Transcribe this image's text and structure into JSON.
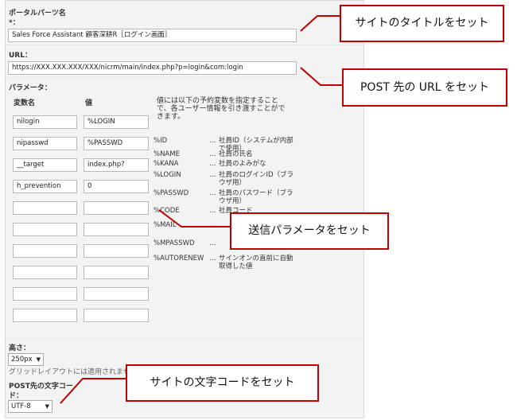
{
  "form": {
    "portal_parts_name": {
      "label": "ポータルパーツ名",
      "required": "*：",
      "value": "Sales Force Assistant 顧客深耕R［ログイン画面］"
    },
    "url": {
      "label": "URL：",
      "value": "https://XXX.XXX.XXX/XXX/nicrm/main/index.php?p=login&com:login"
    },
    "params": {
      "label": "パラメータ：",
      "col_name": "変数名",
      "col_value": "値",
      "rows": [
        {
          "name": "nilogin",
          "value": "%LOGIN"
        },
        {
          "name": "nipasswd",
          "value": "%PASSWD"
        },
        {
          "name": "__target",
          "value": "index.php?"
        },
        {
          "name": "h_prevention",
          "value": "0"
        },
        {
          "name": "",
          "value": ""
        },
        {
          "name": "",
          "value": ""
        },
        {
          "name": "",
          "value": ""
        },
        {
          "name": "",
          "value": ""
        },
        {
          "name": "",
          "value": ""
        },
        {
          "name": "",
          "value": ""
        }
      ],
      "help": "値には以下の予約変数を指定することで、各ユーザー情報を引き渡すことができます。",
      "reserved": [
        {
          "name": "%ID",
          "dots": "…",
          "desc": "社員ID（システムが内部で使用）"
        },
        {
          "name": "%NAME",
          "dots": "…",
          "desc": "社員の氏名"
        },
        {
          "name": "%KANA",
          "dots": "…",
          "desc": "社員のよみがな"
        },
        {
          "name": "%LOGIN",
          "dots": "…",
          "desc": "社員のログインID（ブラウザ用）"
        },
        {
          "name": "%PASSWD",
          "dots": "…",
          "desc": "社員のパスワード（ブラウザ用）"
        },
        {
          "name": "%CODE",
          "dots": "…",
          "desc": "社員コード"
        },
        {
          "name": "%MAIL",
          "dots": "…",
          "desc": ""
        },
        {
          "name": "%MPASSWD",
          "dots": "…",
          "desc": ""
        },
        {
          "name": "%AUTORENEW",
          "dots": "…",
          "desc": "サインオンの直前に自動取得した値"
        }
      ]
    },
    "height": {
      "label": "高さ：",
      "value": "250px",
      "note": "グリッドレイアウトには適用されませ"
    },
    "charset": {
      "label1": "POST先の文字コー",
      "label2": "ド：",
      "value": "UTF-8"
    }
  },
  "callouts": {
    "title": "サイトのタイトルをセット",
    "url": "POST 先の URL をセット",
    "params": "送信パラメータをセット",
    "charset": "サイトの文字コードをセット"
  },
  "colors": {
    "callout_border": "#c00000",
    "panel_bg": "#f3f3f3"
  }
}
